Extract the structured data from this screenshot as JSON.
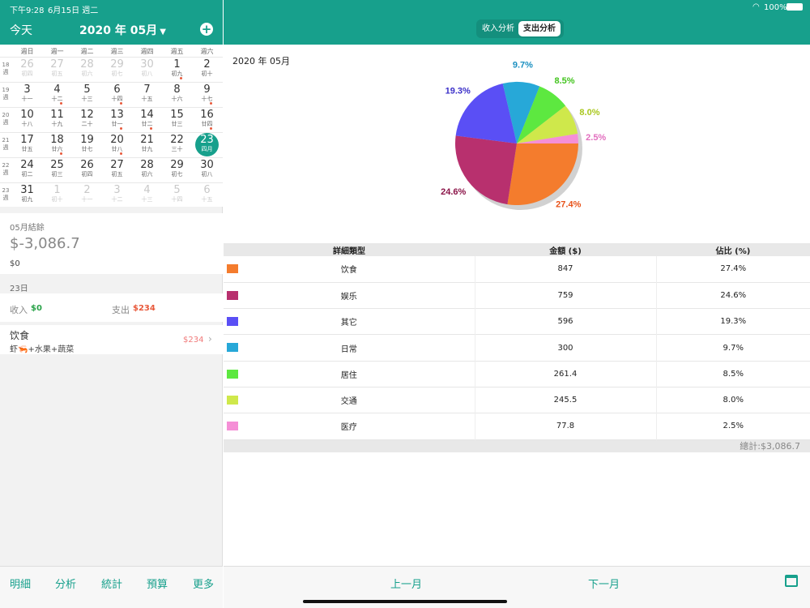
{
  "status": {
    "time": "下午9:28",
    "date": "6月15日 週二",
    "battery": "100%"
  },
  "header": {
    "today": "今天",
    "month_title": "2020 年 05月",
    "add_icon": "plus-circle-icon"
  },
  "segment": {
    "income": "收入分析",
    "expense": "支出分析",
    "selected": "expense"
  },
  "weekdays": [
    "週日",
    "週一",
    "週二",
    "週三",
    "週四",
    "週五",
    "週六"
  ],
  "calendar": {
    "weeks": [
      {
        "no": "18",
        "label": "週",
        "days": [
          {
            "d": "26",
            "l": "初四",
            "dim": true
          },
          {
            "d": "27",
            "l": "初五",
            "dim": true
          },
          {
            "d": "28",
            "l": "初六",
            "dim": true
          },
          {
            "d": "29",
            "l": "初七",
            "dim": true
          },
          {
            "d": "30",
            "l": "初八",
            "dim": true
          },
          {
            "d": "1",
            "l": "初九",
            "dot": true
          },
          {
            "d": "2",
            "l": "初十"
          }
        ]
      },
      {
        "no": "19",
        "label": "週",
        "days": [
          {
            "d": "3",
            "l": "十一"
          },
          {
            "d": "4",
            "l": "十二",
            "dot": true
          },
          {
            "d": "5",
            "l": "十三"
          },
          {
            "d": "6",
            "l": "十四",
            "dot": true
          },
          {
            "d": "7",
            "l": "十五"
          },
          {
            "d": "8",
            "l": "十六"
          },
          {
            "d": "9",
            "l": "十七",
            "dot": true
          }
        ]
      },
      {
        "no": "20",
        "label": "週",
        "days": [
          {
            "d": "10",
            "l": "十八"
          },
          {
            "d": "11",
            "l": "十九"
          },
          {
            "d": "12",
            "l": "二十"
          },
          {
            "d": "13",
            "l": "廿一",
            "dot": true
          },
          {
            "d": "14",
            "l": "廿二",
            "dot": true
          },
          {
            "d": "15",
            "l": "廿三"
          },
          {
            "d": "16",
            "l": "廿四",
            "dot": true
          }
        ]
      },
      {
        "no": "21",
        "label": "週",
        "days": [
          {
            "d": "17",
            "l": "廿五"
          },
          {
            "d": "18",
            "l": "廿六",
            "dot": true
          },
          {
            "d": "19",
            "l": "廿七"
          },
          {
            "d": "20",
            "l": "廿八",
            "dot": true
          },
          {
            "d": "21",
            "l": "廿九"
          },
          {
            "d": "22",
            "l": "三十"
          },
          {
            "d": "23",
            "l": "四月",
            "selected": true
          }
        ]
      },
      {
        "no": "22",
        "label": "週",
        "days": [
          {
            "d": "24",
            "l": "初二"
          },
          {
            "d": "25",
            "l": "初三"
          },
          {
            "d": "26",
            "l": "初四"
          },
          {
            "d": "27",
            "l": "初五"
          },
          {
            "d": "28",
            "l": "初六"
          },
          {
            "d": "29",
            "l": "初七"
          },
          {
            "d": "30",
            "l": "初八"
          }
        ]
      },
      {
        "no": "23",
        "label": "週",
        "days": [
          {
            "d": "31",
            "l": "初九"
          },
          {
            "d": "1",
            "l": "初十",
            "dim": true
          },
          {
            "d": "2",
            "l": "十一",
            "dim": true
          },
          {
            "d": "3",
            "l": "十二",
            "dim": true
          },
          {
            "d": "4",
            "l": "十三",
            "dim": true
          },
          {
            "d": "5",
            "l": "十四",
            "dim": true
          },
          {
            "d": "6",
            "l": "十五",
            "dim": true
          }
        ]
      }
    ]
  },
  "summary": {
    "title": "05月結餘",
    "balance": "$-3,086.7",
    "sub": "$0"
  },
  "day": {
    "title": "23日",
    "income_label": "收入",
    "income_value": "$0",
    "expense_label": "支出",
    "expense_value": "$234"
  },
  "entry": {
    "category": "饮食",
    "note": "虾🦐+水果+蔬菜",
    "amount": "$234"
  },
  "tabs": [
    "明細",
    "分析",
    "統計",
    "預算",
    "更多"
  ],
  "right": {
    "period": "2020 年 05月",
    "table_headers": [
      "詳細類型",
      "金額 ($)",
      "佔比 (%)"
    ],
    "total": "總計:$3,086.7",
    "prev": "上一月",
    "next": "下一月"
  },
  "chart_data": {
    "type": "pie",
    "title": "",
    "series": [
      {
        "category": "饮食",
        "value": 847,
        "percent": "27.4%",
        "color": "#f47c2d"
      },
      {
        "category": "娱乐",
        "value": 759,
        "percent": "24.6%",
        "color": "#b8306e"
      },
      {
        "category": "其它",
        "value": 596,
        "percent": "19.3%",
        "color": "#5a4ff5"
      },
      {
        "category": "日常",
        "value": 300,
        "percent": "9.7%",
        "color": "#27a8d8"
      },
      {
        "category": "居住",
        "value": 261.4,
        "percent": "8.5%",
        "color": "#5de840"
      },
      {
        "category": "交通",
        "value": 245.5,
        "percent": "8.0%",
        "color": "#cfe84b"
      },
      {
        "category": "医疗",
        "value": 77.8,
        "percent": "2.5%",
        "color": "#f58fd6"
      }
    ],
    "label_colors": [
      "#e8531a",
      "#8b1448",
      "#3a2fc8",
      "#1a8fc0",
      "#43c41e",
      "#a9c71d",
      "#e26fbf"
    ]
  }
}
